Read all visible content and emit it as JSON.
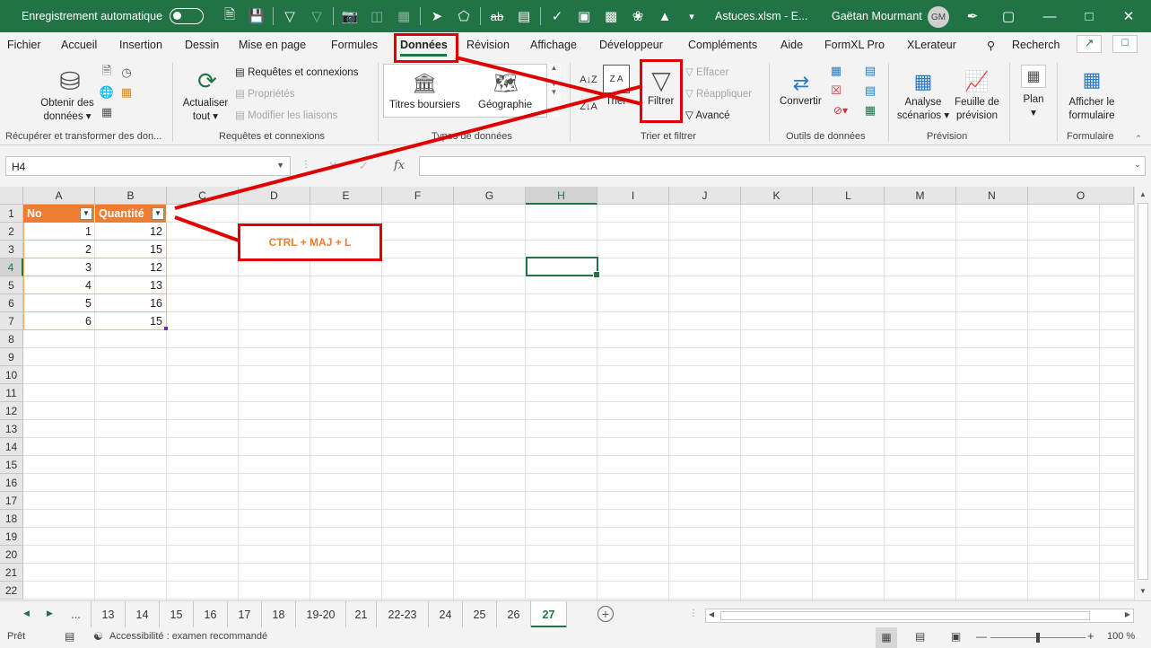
{
  "titlebar": {
    "autosave_label": "Enregistrement automatique",
    "doc_title": "Astuces.xlsm  -  E...",
    "user_name": "Gaëtan Mourmant",
    "avatar_initials": "GM"
  },
  "tabs": {
    "items": [
      "Fichier",
      "Accueil",
      "Insertion",
      "Dessin",
      "Mise en page",
      "Formules",
      "Données",
      "Révision",
      "Affichage",
      "Développeur",
      "Compléments",
      "Aide",
      "FormXL Pro",
      "XLerateur"
    ],
    "active": "Données",
    "search_placeholder": "Recherch"
  },
  "ribbon": {
    "get_data": {
      "label_1": "Obtenir des",
      "label_2": "données ▾",
      "group": "Récupérer et transformer des don..."
    },
    "queries": {
      "refresh_1": "Actualiser",
      "refresh_2": "tout ▾",
      "connections": "Requêtes et connexions",
      "properties": "Propriétés",
      "edit_links": "Modifier les liaisons",
      "group": "Requêtes et connexions"
    },
    "data_types": {
      "stocks": "Titres boursiers",
      "geography": "Géographie",
      "group": "Types de données"
    },
    "sort_filter": {
      "sort": "Trier",
      "filter": "Filtrer",
      "clear": "Effacer",
      "reapply": "Réappliquer",
      "advanced": "Avancé",
      "group": "Trier et filtrer"
    },
    "data_tools": {
      "convert": "Convertir",
      "group": "Outils de données"
    },
    "forecast": {
      "whatif_1": "Analyse",
      "whatif_2": "scénarios ▾",
      "sheet_1": "Feuille de",
      "sheet_2": "prévision",
      "group": "Prévision"
    },
    "outline": {
      "plan": "Plan",
      "plan_arrow": "▾"
    },
    "form": {
      "show_1": "Afficher le",
      "show_2": "formulaire",
      "group": "Formulaire"
    }
  },
  "formula_bar": {
    "name_box": "H4",
    "fx": "fx",
    "value": ""
  },
  "grid": {
    "columns": [
      "A",
      "B",
      "C",
      "D",
      "E",
      "F",
      "G",
      "H",
      "I",
      "J",
      "K",
      "L",
      "M",
      "N",
      "O"
    ],
    "rows": [
      "1",
      "2",
      "3",
      "4",
      "5",
      "6",
      "7",
      "8",
      "9",
      "10",
      "11",
      "12",
      "13",
      "14",
      "15",
      "16",
      "17",
      "18",
      "19",
      "20",
      "21",
      "22"
    ],
    "selected_column": "H",
    "selected_row": "4",
    "table": {
      "headers": [
        "No",
        "Quantité"
      ],
      "rows": [
        [
          "1",
          "12"
        ],
        [
          "2",
          "15"
        ],
        [
          "3",
          "12"
        ],
        [
          "4",
          "13"
        ],
        [
          "5",
          "16"
        ],
        [
          "6",
          "15"
        ]
      ]
    }
  },
  "annotation": {
    "shortcut": "CTRL + MAJ + L",
    "color": "#e00000"
  },
  "sheets": {
    "items": [
      "...",
      "13",
      "14",
      "15",
      "16",
      "17",
      "18",
      "19-20",
      "21",
      "22-23",
      "24",
      "25",
      "26",
      "27"
    ],
    "active": "27"
  },
  "status": {
    "ready": "Prêt",
    "accessibility": "Accessibilité : examen recommandé",
    "zoom": "100 %"
  },
  "colors": {
    "excel_green": "#217346",
    "table_header": "#ed7d31"
  }
}
